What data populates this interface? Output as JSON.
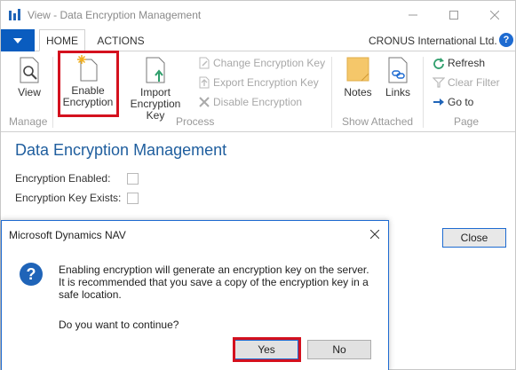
{
  "window": {
    "title": "View - Data Encryption Management"
  },
  "tabs": {
    "home": "HOME",
    "actions": "ACTIONS"
  },
  "company": "CRONUS International Ltd.",
  "help": "?",
  "ribbon": {
    "view": "View",
    "enable_line1": "Enable",
    "enable_line2": "Encryption",
    "import_line1": "Import",
    "import_line2": "Encryption Key",
    "change_key": "Change Encryption Key",
    "export_key": "Export Encryption Key",
    "disable": "Disable Encryption",
    "notes": "Notes",
    "links": "Links",
    "refresh": "Refresh",
    "clear_filter": "Clear Filter",
    "goto": "Go to",
    "groups": {
      "manage": "Manage",
      "process": "Process",
      "show_attached": "Show Attached",
      "page": "Page"
    }
  },
  "page": {
    "title": "Data Encryption Management",
    "fields": [
      {
        "label": "Encryption Enabled:",
        "checked": false
      },
      {
        "label": "Encryption Key Exists:",
        "checked": false
      }
    ],
    "close": "Close"
  },
  "dialog": {
    "title": "Microsoft Dynamics NAV",
    "icon": "question-icon",
    "message_line1": "Enabling encryption will generate an encryption key on the server.",
    "message_line2": "It is recommended that you save a copy of the encryption key in a",
    "message_line3": "safe location.",
    "question": "Do you want to continue?",
    "yes": "Yes",
    "no": "No"
  },
  "colors": {
    "accent": "#1e6bd1",
    "app_menu": "#0a5cbf",
    "title_blue": "#1f5e9e",
    "highlight_red": "#d4111e"
  }
}
